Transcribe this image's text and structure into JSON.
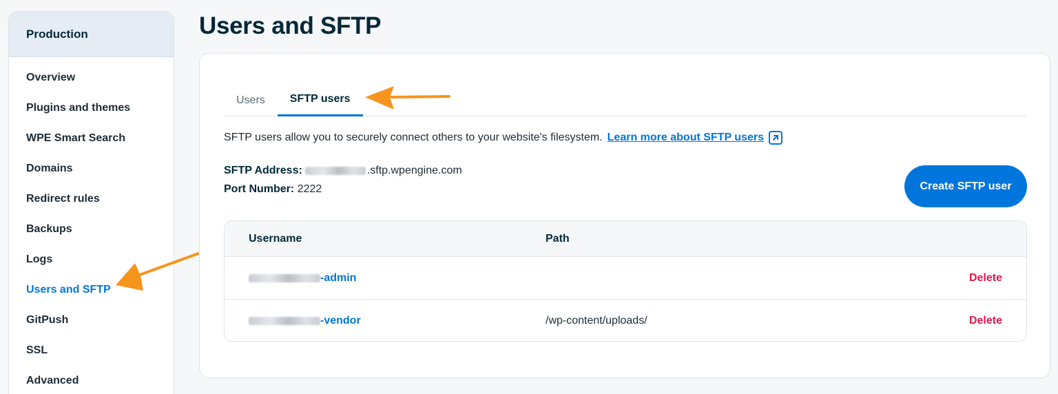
{
  "sidebar": {
    "header": "Production",
    "items": [
      {
        "label": "Overview"
      },
      {
        "label": "Plugins and themes"
      },
      {
        "label": "WPE Smart Search"
      },
      {
        "label": "Domains"
      },
      {
        "label": "Redirect rules"
      },
      {
        "label": "Backups"
      },
      {
        "label": "Logs"
      },
      {
        "label": "Users and SFTP",
        "active": true
      },
      {
        "label": "GitPush"
      },
      {
        "label": "SSL"
      },
      {
        "label": "Advanced"
      }
    ]
  },
  "page": {
    "title": "Users and SFTP"
  },
  "tabs": [
    {
      "label": "Users"
    },
    {
      "label": "SFTP users",
      "active": true
    }
  ],
  "description": {
    "text": "SFTP users allow you to securely connect others to your website's filesystem.",
    "link": "Learn more about SFTP users"
  },
  "sftp": {
    "address_label": "SFTP Address:",
    "address_suffix": ".sftp.wpengine.com",
    "port_label": "Port Number:",
    "port_value": "2222"
  },
  "create_button": "Create SFTP user",
  "table": {
    "headers": {
      "username": "Username",
      "path": "Path"
    },
    "rows": [
      {
        "username_suffix": "-admin",
        "path": "",
        "action": "Delete"
      },
      {
        "username_suffix": "-vendor",
        "path": "/wp-content/uploads/",
        "action": "Delete"
      }
    ]
  },
  "colors": {
    "accent": "#0076dc",
    "danger": "#e0174b",
    "annotation_arrow": "#f7941d"
  },
  "icons": {
    "external_link": "external-link-icon",
    "annotation": "arrow-annotation-icon"
  }
}
